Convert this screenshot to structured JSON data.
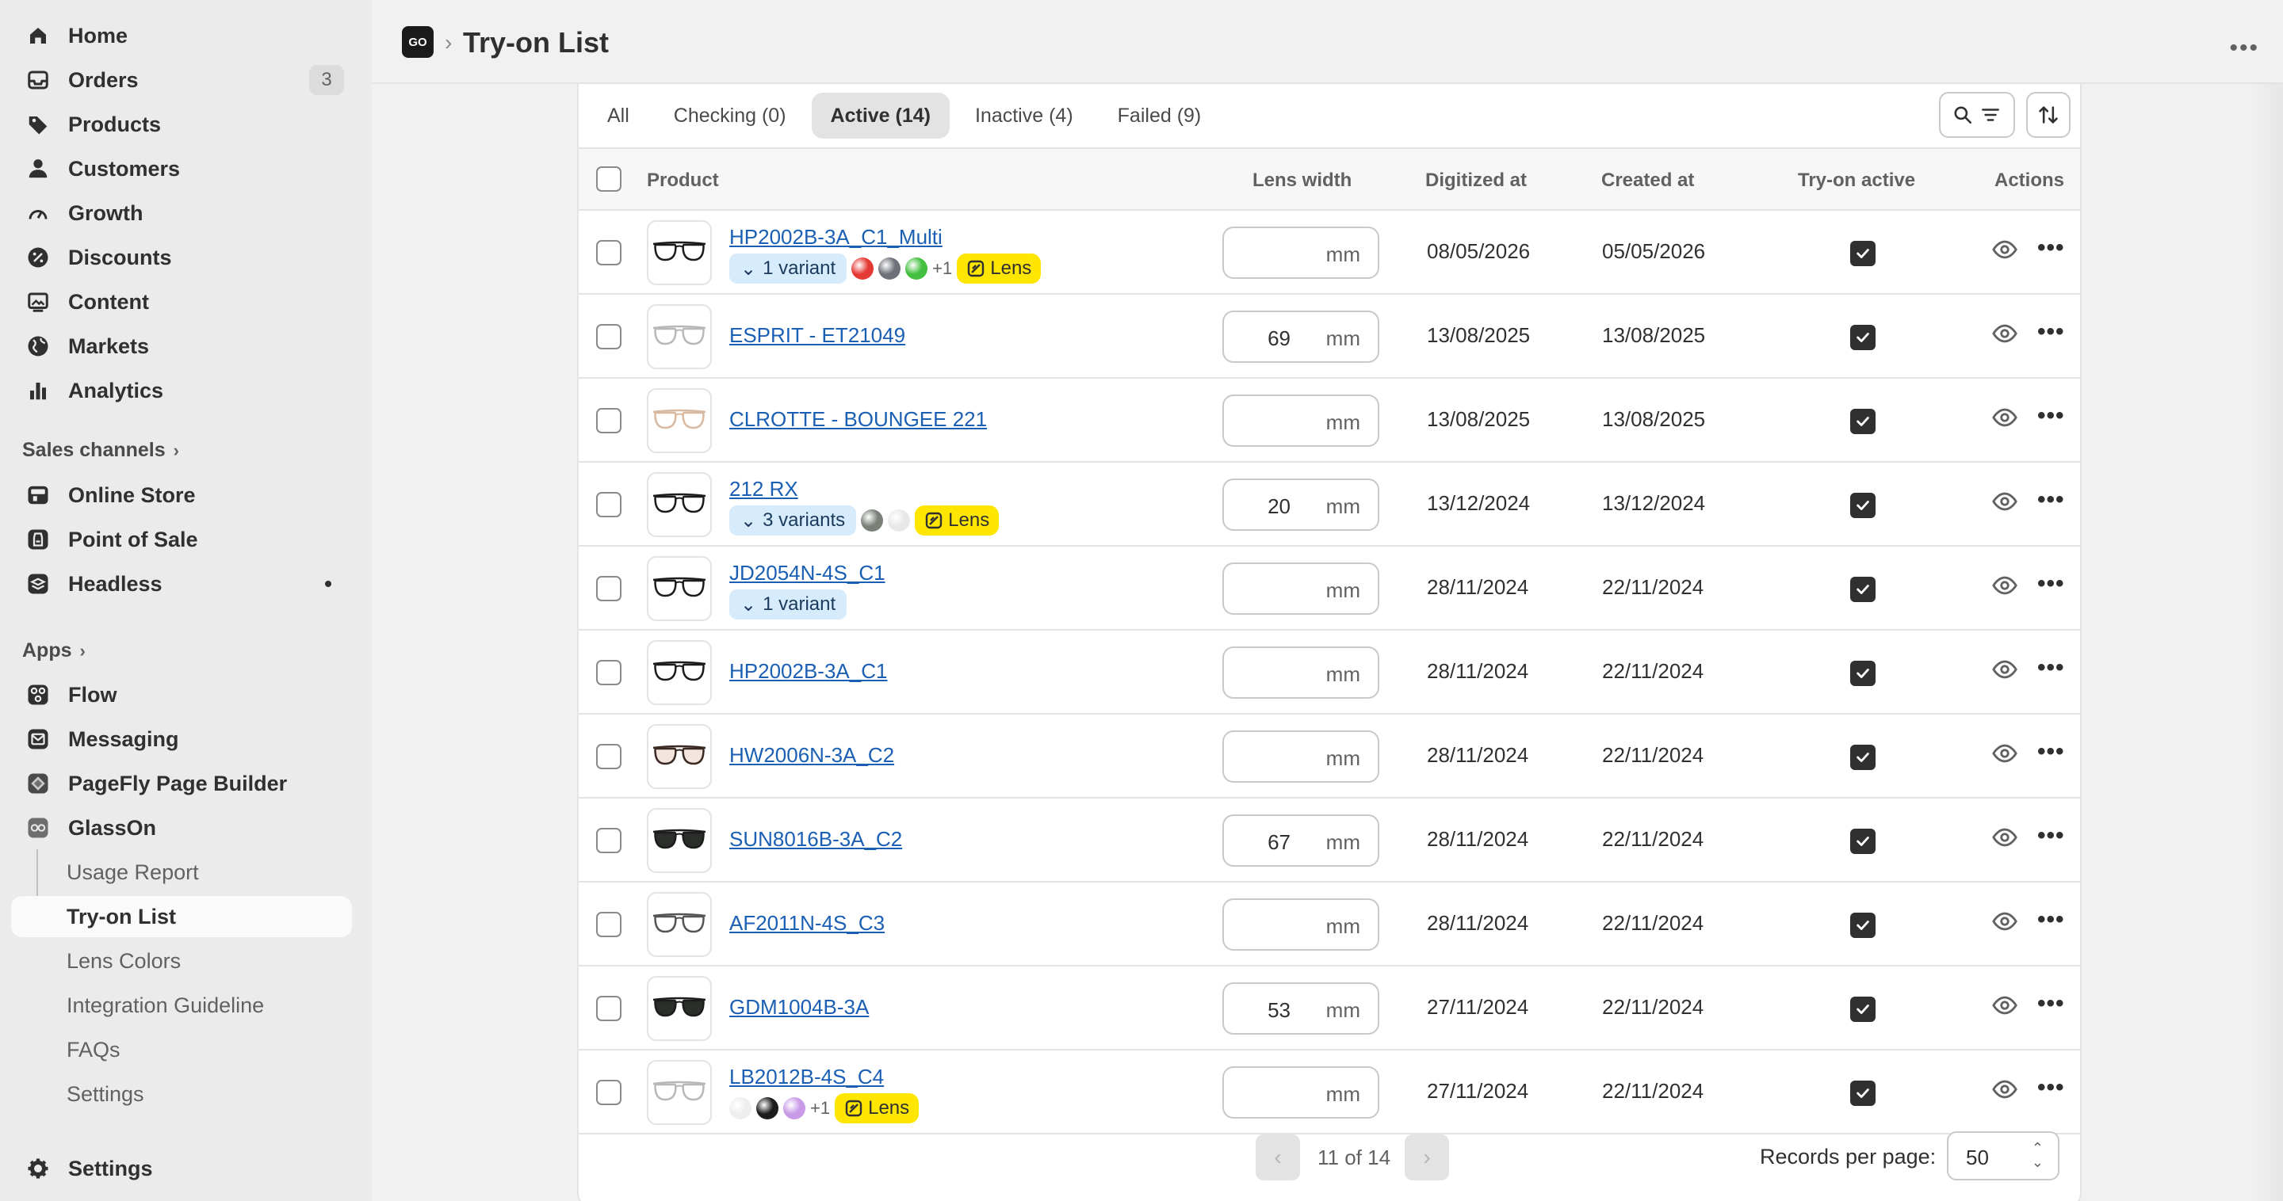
{
  "sidebar": {
    "items": [
      {
        "label": "Home",
        "icon": "home-icon"
      },
      {
        "label": "Orders",
        "icon": "inbox-icon",
        "badge": "3"
      },
      {
        "label": "Products",
        "icon": "tag-icon"
      },
      {
        "label": "Customers",
        "icon": "person-icon"
      },
      {
        "label": "Growth",
        "icon": "gauge-icon"
      },
      {
        "label": "Discounts",
        "icon": "discount-icon"
      },
      {
        "label": "Content",
        "icon": "content-icon"
      },
      {
        "label": "Markets",
        "icon": "globe-icon"
      },
      {
        "label": "Analytics",
        "icon": "bar-chart-icon"
      }
    ],
    "sales_channels_label": "Sales channels",
    "channels": [
      {
        "label": "Online Store",
        "icon": "store-icon"
      },
      {
        "label": "Point of Sale",
        "icon": "pos-icon"
      },
      {
        "label": "Headless",
        "icon": "headless-icon"
      }
    ],
    "apps_label": "Apps",
    "apps": [
      {
        "label": "Flow",
        "icon": "flow-icon"
      },
      {
        "label": "Messaging",
        "icon": "mail-icon"
      },
      {
        "label": "PageFly Page Builder",
        "icon": "pagefly-icon"
      },
      {
        "label": "GlassOn",
        "icon": "glasses-icon"
      }
    ],
    "glasson_sub": [
      "Usage Report",
      "Try-on List",
      "Lens Colors",
      "Integration Guideline",
      "FAQs",
      "Settings"
    ],
    "settings_label": "Settings"
  },
  "header": {
    "logo_text": "GO",
    "separator": "›",
    "title": "Try-on List"
  },
  "tabs": [
    "All",
    "Checking (0)",
    "Active (14)",
    "Inactive (4)",
    "Failed (9)"
  ],
  "columns": {
    "product": "Product",
    "lens_width": "Lens width",
    "digitized": "Digitized at",
    "created": "Created at",
    "tryon": "Try-on active",
    "actions": "Actions"
  },
  "unit": "mm",
  "lens_tag": "Lens",
  "rows": [
    {
      "name": "HP2002B-3A_C1_Multi",
      "variants": "1 variant",
      "swatches": [
        "#e53935",
        "#6e7178",
        "#43c03f"
      ],
      "plus": "+1",
      "lens": true,
      "lens_width": "",
      "digitized": "08/05/2026",
      "created": "05/05/2026",
      "frame": "dark"
    },
    {
      "name": "ESPRIT - ET21049",
      "variants": "",
      "swatches": [],
      "plus": "",
      "lens": false,
      "lens_width": "69",
      "digitized": "13/08/2025",
      "created": "13/08/2025",
      "frame": "light"
    },
    {
      "name": "CLROTTE - BOUNGEE 221",
      "variants": "",
      "swatches": [],
      "plus": "",
      "lens": false,
      "lens_width": "",
      "digitized": "13/08/2025",
      "created": "13/08/2025",
      "frame": "gold"
    },
    {
      "name": "212 RX",
      "variants": "3 variants",
      "swatches": [
        "#7a8078",
        "#e8e8e8"
      ],
      "plus": "",
      "lens": true,
      "lens_width": "20",
      "digitized": "13/12/2024",
      "created": "13/12/2024",
      "frame": "dark"
    },
    {
      "name": "JD2054N-4S_C1",
      "variants": "1 variant",
      "swatches": [],
      "plus": "",
      "lens": false,
      "lens_width": "",
      "digitized": "28/11/2024",
      "created": "22/11/2024",
      "frame": "dark"
    },
    {
      "name": "HP2002B-3A_C1",
      "variants": "",
      "swatches": [],
      "plus": "",
      "lens": false,
      "lens_width": "",
      "digitized": "28/11/2024",
      "created": "22/11/2024",
      "frame": "dark"
    },
    {
      "name": "HW2006N-3A_C2",
      "variants": "",
      "swatches": [],
      "plus": "",
      "lens": false,
      "lens_width": "",
      "digitized": "28/11/2024",
      "created": "22/11/2024",
      "frame": "brown"
    },
    {
      "name": "SUN8016B-3A_C2",
      "variants": "",
      "swatches": [],
      "plus": "",
      "lens": false,
      "lens_width": "67",
      "digitized": "28/11/2024",
      "created": "22/11/2024",
      "frame": "sun"
    },
    {
      "name": "AF2011N-4S_C3",
      "variants": "",
      "swatches": [],
      "plus": "",
      "lens": false,
      "lens_width": "",
      "digitized": "28/11/2024",
      "created": "22/11/2024",
      "frame": "grey"
    },
    {
      "name": "GDM1004B-3A",
      "variants": "",
      "swatches": [],
      "plus": "",
      "lens": false,
      "lens_width": "53",
      "digitized": "27/11/2024",
      "created": "22/11/2024",
      "frame": "sun"
    },
    {
      "name": "LB2012B-4S_C4",
      "variants": "",
      "swatches": [
        "#eeeeee",
        "#1c1c1c",
        "#c99ae8"
      ],
      "plus": "+1",
      "lens": true,
      "lens_width": "",
      "digitized": "27/11/2024",
      "created": "22/11/2024",
      "frame": "light"
    }
  ],
  "pagination": {
    "text": "11 of 14",
    "records_label": "Records per page:",
    "records_value": "50"
  },
  "colors": {
    "accent_link": "#1a5fb4",
    "lens_tag": "#ffe600",
    "variant_badge": "#d6ebfb"
  }
}
